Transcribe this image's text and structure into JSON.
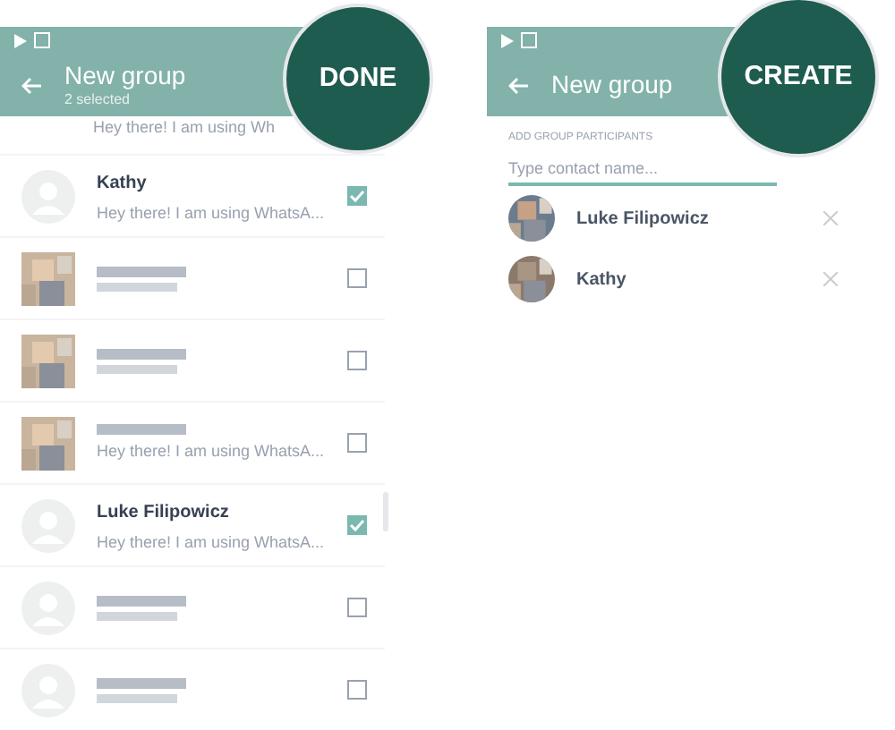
{
  "select_screen": {
    "title": "New group",
    "subtitle": "2 selected",
    "action": "DONE",
    "contacts": [
      {
        "kind": "partial",
        "status": "Hey there! I am using Wh"
      },
      {
        "kind": "contact",
        "name": "Kathy",
        "status": "Hey there! I am using WhatsA...",
        "avatar": {
          "kind": "default"
        },
        "checked": true
      },
      {
        "kind": "redacted",
        "checked": false
      },
      {
        "kind": "redacted",
        "checked": false
      },
      {
        "kind": "redacted",
        "status": "Hey there! I am using WhatsA...",
        "checked": false
      },
      {
        "kind": "contact",
        "name": "Luke Filipowicz",
        "status": "Hey there! I am using WhatsA...",
        "avatar": {
          "kind": "default"
        },
        "checked": true
      },
      {
        "kind": "redacted",
        "avatar": {
          "kind": "default"
        },
        "checked": false
      },
      {
        "kind": "redacted",
        "avatar": {
          "kind": "default"
        },
        "checked": false
      }
    ]
  },
  "create_screen": {
    "title": "New group",
    "action": "CREATE",
    "section_label": "ADD GROUP PARTICIPANTS",
    "search": {
      "placeholder": "Type contact name..."
    },
    "participants": [
      {
        "name": "Luke Filipowicz"
      },
      {
        "name": "Kathy"
      }
    ]
  }
}
